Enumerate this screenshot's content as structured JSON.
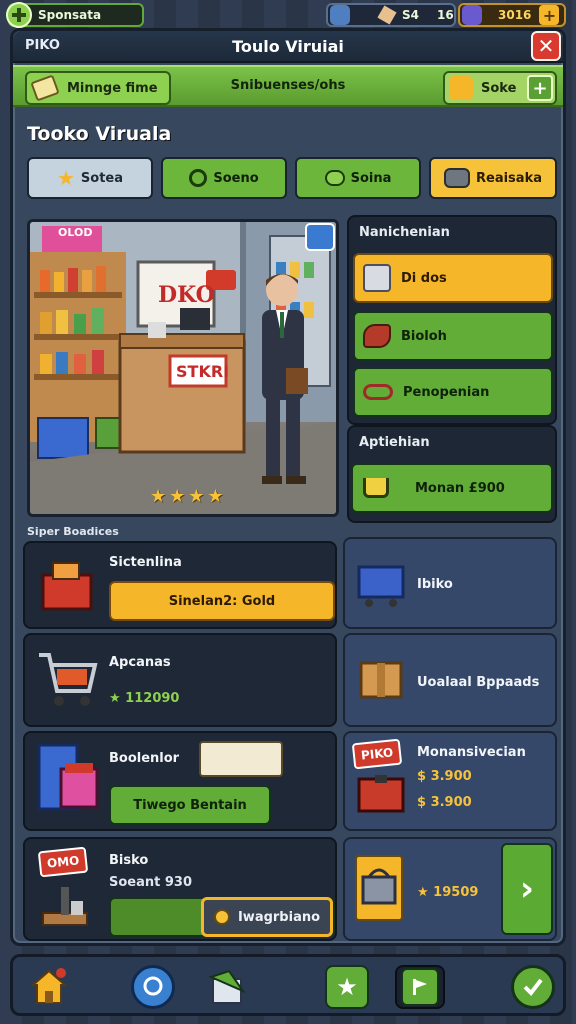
{
  "topbar": {
    "player_label": "Sponsata",
    "stat_a": "S4",
    "stat_b": "16",
    "gold": "3016"
  },
  "window": {
    "left_title": "PIKO",
    "title": "Toulo Viruiai",
    "close_label": "✕"
  },
  "green_bar": {
    "left_button": "Minnge fime",
    "center_text": "Snibuenses/ohs",
    "right_button": "Soke",
    "plus_label": "+"
  },
  "section_title": "Tooko Viruala",
  "tabs": [
    {
      "label": "Sotea",
      "style": "light",
      "icon": "star-icon"
    },
    {
      "label": "Soeno",
      "style": "green",
      "icon": "swirl-icon"
    },
    {
      "label": "Soina",
      "style": "green",
      "icon": "bubble-icon"
    },
    {
      "label": "Reaisaka",
      "style": "yellow",
      "icon": "robot-icon"
    }
  ],
  "preview": {
    "sign_text": "DKO",
    "counter_text": "STKRI",
    "top_sign": "OLOD",
    "stars": 4
  },
  "info_panel": {
    "header": "Nanichenian",
    "options": [
      {
        "label": "Di dos",
        "style": "yellow",
        "icon": "box-icon"
      },
      {
        "label": "Bioloh",
        "style": "green",
        "icon": "meat-icon"
      },
      {
        "label": "Penopenian",
        "style": "green",
        "icon": "glasses-icon"
      }
    ]
  },
  "bottom_panel": {
    "header": "Aptiehian",
    "buy_label": "Monan £900"
  },
  "sub_title": "Siper Boadices",
  "cards": [
    {
      "name": "Sictenlina",
      "button": "Sinelan2: Gold",
      "style": "dark",
      "icon": "basket-red-icon"
    },
    {
      "name": "Ibiko",
      "style": "blue",
      "icon": "cart-blue-icon"
    },
    {
      "name": "Apcanas",
      "price": "★ 112090",
      "style": "dark",
      "icon": "cart-icon"
    },
    {
      "name": "Uoalaal Bppaads",
      "style": "blue",
      "icon": "parcel-icon"
    },
    {
      "name": "Boolenlor",
      "button": "Tiwego Bentain",
      "style": "dark",
      "icon": "machine-icon"
    },
    {
      "name": "Monansivecian",
      "price1": "$ 3.900",
      "price2": "$ 3.900",
      "badge": "PIKO",
      "style": "blue",
      "icon": "red-box-icon"
    },
    {
      "name": "Bisko",
      "subtext": "Soeant 930",
      "button": "Iwagrbiano",
      "badge": "OMO",
      "style": "dark",
      "icon": "stand-icon"
    },
    {
      "price": "★ 19509",
      "arrow": "›",
      "style": "blue",
      "icon": "basket-gold-icon"
    }
  ],
  "colors": {
    "accent_green": "#62ac38",
    "accent_yellow": "#f6b62a",
    "close_red": "#d93a2f",
    "panel_dark": "#1d2736"
  }
}
